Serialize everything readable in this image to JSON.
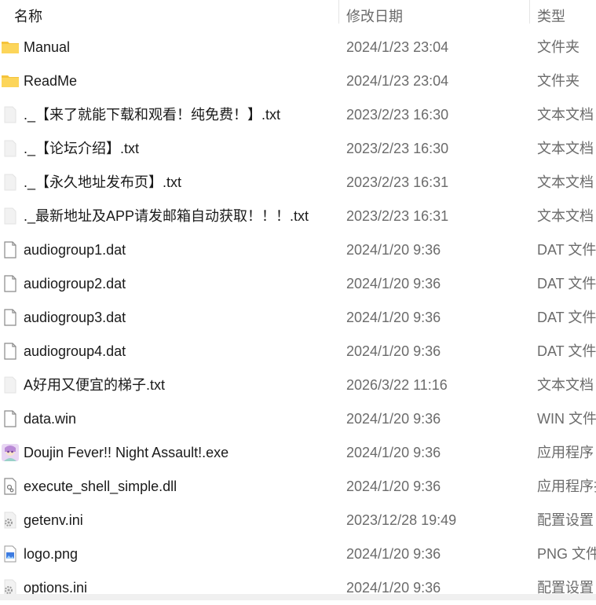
{
  "columns": {
    "name": "名称",
    "date": "修改日期",
    "type": "类型"
  },
  "files": [
    {
      "name": "Manual",
      "date": "2024/1/23 23:04",
      "type": "文件夹",
      "icon": "folder-icon"
    },
    {
      "name": "ReadMe",
      "date": "2024/1/23 23:04",
      "type": "文件夹",
      "icon": "folder-icon"
    },
    {
      "name": "._【来了就能下载和观看！纯免费！】.txt",
      "date": "2023/2/23 16:30",
      "type": "文本文档",
      "icon": "text-file-icon"
    },
    {
      "name": "._【论坛介绍】.txt",
      "date": "2023/2/23 16:30",
      "type": "文本文档",
      "icon": "text-file-icon"
    },
    {
      "name": "._【永久地址发布页】.txt",
      "date": "2023/2/23 16:31",
      "type": "文本文档",
      "icon": "text-file-icon"
    },
    {
      "name": "._最新地址及APP请发邮箱自动获取！！！.txt",
      "date": "2023/2/23 16:31",
      "type": "文本文档",
      "icon": "text-file-icon"
    },
    {
      "name": "audiogroup1.dat",
      "date": "2024/1/20 9:36",
      "type": "DAT 文件",
      "icon": "generic-file-icon"
    },
    {
      "name": "audiogroup2.dat",
      "date": "2024/1/20 9:36",
      "type": "DAT 文件",
      "icon": "generic-file-icon"
    },
    {
      "name": "audiogroup3.dat",
      "date": "2024/1/20 9:36",
      "type": "DAT 文件",
      "icon": "generic-file-icon"
    },
    {
      "name": "audiogroup4.dat",
      "date": "2024/1/20 9:36",
      "type": "DAT 文件",
      "icon": "generic-file-icon"
    },
    {
      "name": "A好用又便宜的梯子.txt",
      "date": "2026/3/22 11:16",
      "type": "文本文档",
      "icon": "text-file-icon"
    },
    {
      "name": "data.win",
      "date": "2024/1/20 9:36",
      "type": "WIN 文件",
      "icon": "generic-file-icon"
    },
    {
      "name": "Doujin Fever!! Night Assault!.exe",
      "date": "2024/1/20 9:36",
      "type": "应用程序",
      "icon": "app-exe-icon"
    },
    {
      "name": "execute_shell_simple.dll",
      "date": "2024/1/20 9:36",
      "type": "应用程序扩展",
      "icon": "dll-file-icon"
    },
    {
      "name": "getenv.ini",
      "date": "2023/12/28 19:49",
      "type": "配置设置",
      "icon": "ini-settings-icon"
    },
    {
      "name": "logo.png",
      "date": "2024/1/20 9:36",
      "type": "PNG 文件",
      "icon": "image-file-icon"
    },
    {
      "name": "options.ini",
      "date": "2024/1/20 9:36",
      "type": "配置设置",
      "icon": "ini-settings-icon"
    }
  ]
}
